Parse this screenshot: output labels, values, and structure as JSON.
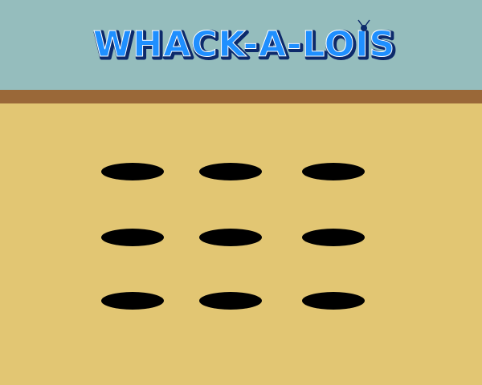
{
  "game": {
    "title": "WHACK-A-LOIS"
  },
  "colors": {
    "sky": "#95bdbd",
    "dirt_strip": "#9a6838",
    "field": "#e2c673",
    "hole": "#000000",
    "logo_fill": "#1f8fff",
    "logo_outline": "#0d2a6b"
  },
  "board": {
    "rows": 3,
    "columns": 3,
    "holes": [
      {
        "row": 1,
        "column": 1
      },
      {
        "row": 1,
        "column": 2
      },
      {
        "row": 1,
        "column": 3
      },
      {
        "row": 2,
        "column": 1
      },
      {
        "row": 2,
        "column": 2
      },
      {
        "row": 2,
        "column": 3
      },
      {
        "row": 3,
        "column": 1
      },
      {
        "row": 3,
        "column": 2
      },
      {
        "row": 3,
        "column": 3
      }
    ]
  }
}
